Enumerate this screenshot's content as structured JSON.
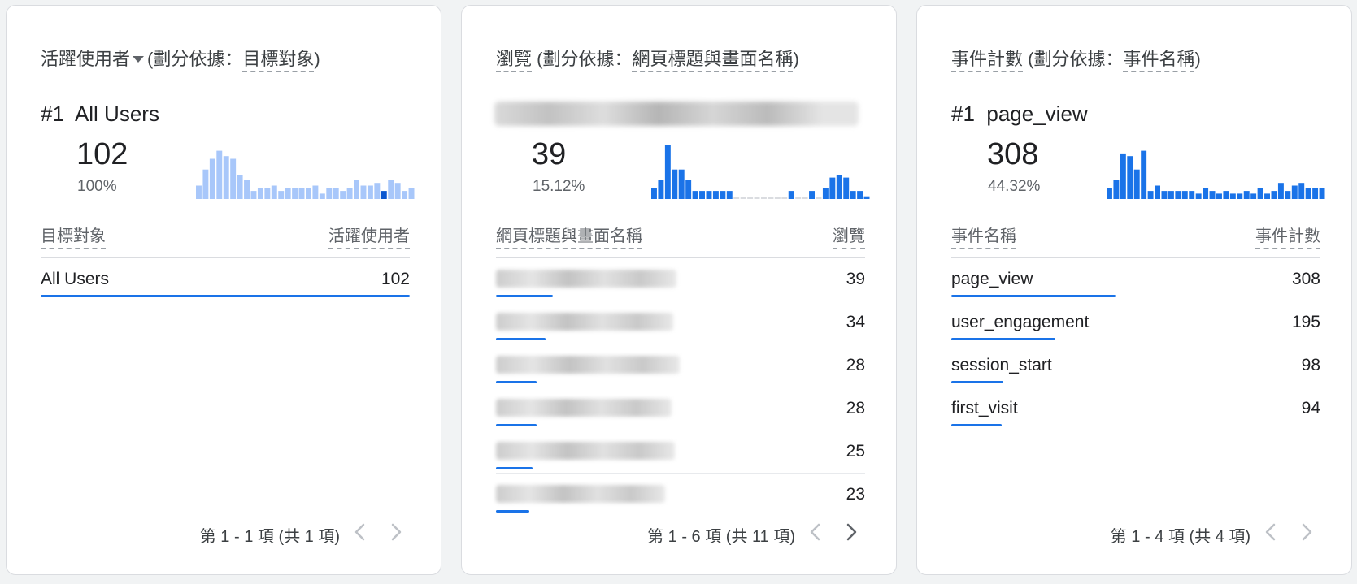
{
  "cards": [
    {
      "title_metric": "活躍使用者",
      "title_prefix": "(劃分依據：",
      "title_dimension": "目標對象",
      "title_suffix": ")",
      "rank_label": "#1",
      "top_item": "All Users",
      "total": "102",
      "percent": "100%",
      "col_dimension": "目標對象",
      "col_metric": "活躍使用者",
      "rows": [
        {
          "label": "All Users",
          "value": "102",
          "fraction": 1.0
        }
      ],
      "pagination": "第 1 - 1 項 (共 1 項)",
      "sparkline": [
        0.25,
        0.55,
        0.75,
        0.9,
        0.8,
        0.75,
        0.45,
        0.35,
        0.15,
        0.2,
        0.2,
        0.25,
        0.15,
        0.2,
        0.2,
        0.2,
        0.2,
        0.25,
        0.1,
        0.2,
        0.2,
        0.15,
        0.2,
        0.35,
        0.25,
        0.25,
        0.3,
        0.15,
        0.35,
        0.3,
        0.15,
        0.2
      ],
      "sparkline_highlight": 27
    },
    {
      "title_metric": "瀏覽",
      "title_prefix": "(劃分依據：",
      "title_dimension": "網頁標題與畫面名稱",
      "title_suffix": ")",
      "total": "39",
      "percent": "15.12%",
      "col_dimension": "網頁標題與畫面名稱",
      "col_metric": "瀏覽",
      "rows": [
        {
          "value": "39",
          "fraction": 0.155
        },
        {
          "value": "34",
          "fraction": 0.135
        },
        {
          "value": "28",
          "fraction": 0.111
        },
        {
          "value": "28",
          "fraction": 0.111
        },
        {
          "value": "25",
          "fraction": 0.099
        },
        {
          "value": "23",
          "fraction": 0.091
        }
      ],
      "pagination": "第 1 - 6 項 (共 11 項)",
      "sparkline": [
        0.2,
        0.35,
        1.0,
        0.55,
        0.55,
        0.35,
        0.15,
        0.15,
        0.15,
        0.15,
        0.15,
        0.15,
        0.02,
        0.02,
        0.02,
        0.02,
        0.02,
        0.02,
        0.02,
        0.02,
        0.15,
        0.02,
        0.02,
        0.15,
        0.02,
        0.2,
        0.4,
        0.45,
        0.4,
        0.15,
        0.15,
        0.05
      ]
    },
    {
      "title_metric": "事件計數",
      "title_prefix": "(劃分依據：",
      "title_dimension": "事件名稱",
      "title_suffix": ")",
      "rank_label": "#1",
      "top_item": "page_view",
      "total": "308",
      "percent": "44.32%",
      "col_dimension": "事件名稱",
      "col_metric": "事件計數",
      "rows": [
        {
          "label": "page_view",
          "value": "308",
          "fraction": 0.445
        },
        {
          "label": "user_engagement",
          "value": "195",
          "fraction": 0.282
        },
        {
          "label": "session_start",
          "value": "98",
          "fraction": 0.142
        },
        {
          "label": "first_visit",
          "value": "94",
          "fraction": 0.136
        }
      ],
      "pagination": "第 1 - 4 項 (共 4 項)",
      "sparkline": [
        0.2,
        0.35,
        0.85,
        0.8,
        0.55,
        0.9,
        0.15,
        0.25,
        0.15,
        0.15,
        0.15,
        0.15,
        0.15,
        0.1,
        0.2,
        0.15,
        0.1,
        0.15,
        0.1,
        0.1,
        0.15,
        0.1,
        0.2,
        0.1,
        0.15,
        0.3,
        0.15,
        0.25,
        0.3,
        0.2,
        0.2,
        0.2
      ]
    }
  ],
  "colors": {
    "accent": "#1a73e8",
    "spark_light": "#a8c7fa",
    "spark_dark": "#0b57d0",
    "spark_zero": "#dadce0",
    "nav_disabled": "#bdc1c6",
    "nav_enabled": "#5f6368"
  }
}
